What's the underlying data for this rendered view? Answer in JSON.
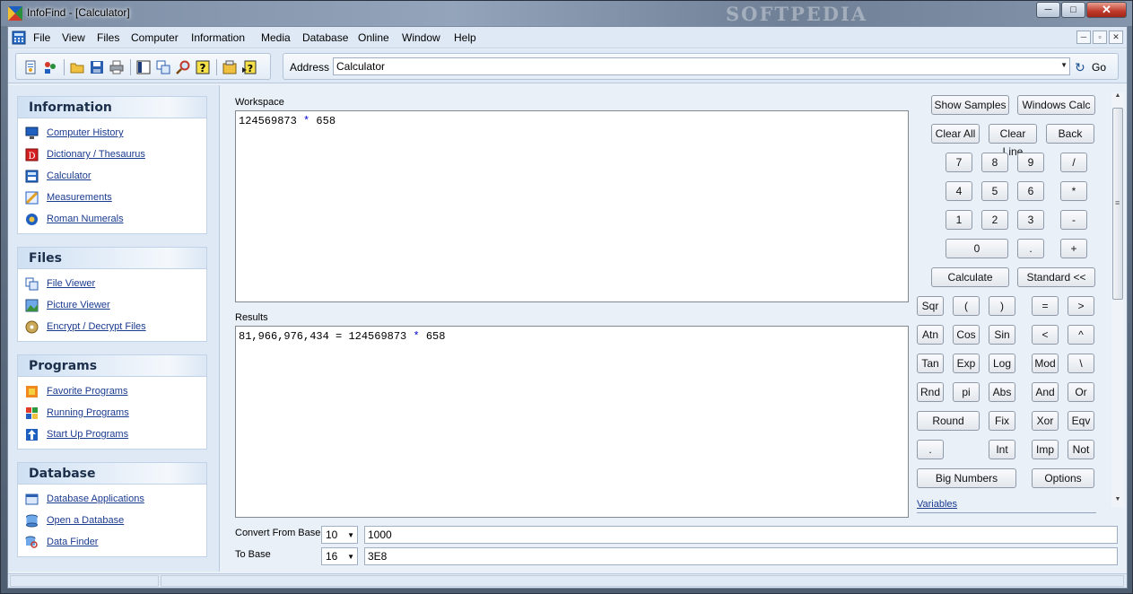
{
  "window": {
    "title": "InfoFind - [Calculator]",
    "watermark": "SOFTPEDIA",
    "min_glyph": "─",
    "max_glyph": "□",
    "close_glyph": "✕"
  },
  "menubar": {
    "items": [
      "File",
      "View",
      "Files",
      "Computer",
      "Information",
      "Media",
      "Database",
      "Online",
      "Window",
      "Help"
    ],
    "mdi_min": "─",
    "mdi_restore": "▫",
    "mdi_close": "✕"
  },
  "toolbar": {
    "address_label": "Address",
    "address_value": "Calculator",
    "dropdown_glyph": "▼",
    "go_glyph": "↻",
    "go_label": "Go"
  },
  "sidebar": {
    "sections": [
      {
        "title": "Information",
        "items": [
          "Computer History",
          "Dictionary / Thesaurus",
          "Calculator",
          "Measurements",
          "Roman Numerals"
        ]
      },
      {
        "title": "Files",
        "items": [
          "File Viewer",
          "Picture Viewer",
          "Encrypt / Decrypt Files"
        ]
      },
      {
        "title": "Programs",
        "items": [
          "Favorite Programs",
          "Running Programs",
          "Start Up Programs"
        ]
      },
      {
        "title": "Database",
        "items": [
          "Database Applications",
          "Open a Database",
          "Data Finder"
        ]
      }
    ]
  },
  "workspace": {
    "label": "Workspace",
    "expr_number": "124569873",
    "expr_op": "*",
    "expr_operand": "658"
  },
  "results": {
    "label": "Results",
    "answer": "81,966,976,434",
    "equals": "=",
    "expr_number": "124569873",
    "expr_op": "*",
    "expr_operand": "658"
  },
  "calculator": {
    "buttons": {
      "show_samples": "Show Samples",
      "windows_calc": "Windows Calc",
      "clear_all": "Clear All",
      "clear_line": "Clear Line",
      "back": "Back",
      "d7": "7",
      "d8": "8",
      "d9": "9",
      "div": "/",
      "d4": "4",
      "d5": "5",
      "d6": "6",
      "mul": "*",
      "d1": "1",
      "d2": "2",
      "d3": "3",
      "sub": "-",
      "d0": "0",
      "dot": ".",
      "add": "+",
      "calculate": "Calculate",
      "standard": "Standard <<",
      "sqr": "Sqr",
      "lparen": "(",
      "rparen": ")",
      "eq": "=",
      "gt": ">",
      "atn": "Atn",
      "cos": "Cos",
      "sin": "Sin",
      "lt": "<",
      "pow": "^",
      "tan": "Tan",
      "exp": "Exp",
      "log": "Log",
      "mod": "Mod",
      "idiv": "\\",
      "rnd": "Rnd",
      "pi": "pi",
      "abs": "Abs",
      "and": "And",
      "or": "Or",
      "round": "Round",
      "fix": "Fix",
      "xor": "Xor",
      "eqv": "Eqv",
      "dot2": ".",
      "int": "Int",
      "imp": "Imp",
      "not": "Not",
      "big_numbers": "Big Numbers",
      "options": "Options"
    },
    "variables_link": "Variables",
    "scroll_up_glyph": "▲",
    "scroll_down_glyph": "▼",
    "scroll_grip_glyph": "≡"
  },
  "convert": {
    "from_label": "Convert From Base",
    "from_base": "10",
    "from_value": "1000",
    "to_label": "To Base",
    "to_base": "16",
    "to_value": "3E8",
    "dropdown_glyph": "▼"
  },
  "colors": {
    "accent": "#1a3a8f",
    "operator": "#0000d0"
  }
}
